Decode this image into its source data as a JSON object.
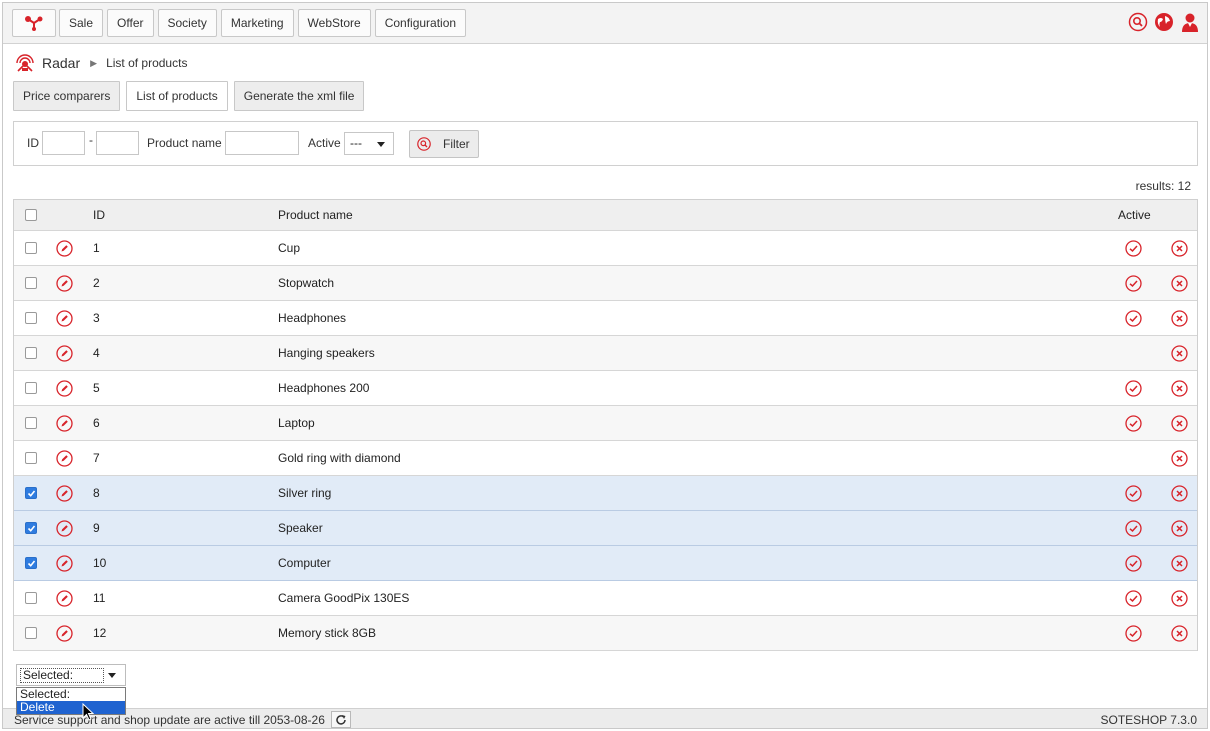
{
  "nav": {
    "logo_icon": "soteshop-logo-icon",
    "items": [
      {
        "label": "Sale"
      },
      {
        "label": "Offer"
      },
      {
        "label": "Society"
      },
      {
        "label": "Marketing"
      },
      {
        "label": "WebStore"
      },
      {
        "label": "Configuration"
      }
    ],
    "right_icons": [
      "search-icon",
      "globe-icon",
      "user-icon"
    ]
  },
  "breadcrumb": {
    "icon": "radar-icon",
    "section": "Radar",
    "current": "List of products"
  },
  "tabs": [
    {
      "label": "Price comparers",
      "active": false
    },
    {
      "label": "List of products",
      "active": true
    },
    {
      "label": "Generate the xml file",
      "active": false
    }
  ],
  "filter": {
    "id_label": "ID",
    "range_sep": "-",
    "product_name_label": "Product name",
    "active_label": "Active",
    "active_value": "---",
    "button_label": "Filter",
    "id_from": "",
    "id_to": "",
    "product_name": ""
  },
  "results": "results: 12",
  "table": {
    "headers": {
      "id": "ID",
      "name": "Product name",
      "active": "Active"
    },
    "rows": [
      {
        "id": "1",
        "name": "Cup",
        "active": true,
        "checked": false
      },
      {
        "id": "2",
        "name": "Stopwatch",
        "active": true,
        "checked": false
      },
      {
        "id": "3",
        "name": "Headphones",
        "active": true,
        "checked": false
      },
      {
        "id": "4",
        "name": "Hanging speakers",
        "active": false,
        "checked": false
      },
      {
        "id": "5",
        "name": "Headphones 200",
        "active": true,
        "checked": false
      },
      {
        "id": "6",
        "name": "Laptop",
        "active": true,
        "checked": false
      },
      {
        "id": "7",
        "name": "Gold ring with diamond",
        "active": false,
        "checked": false
      },
      {
        "id": "8",
        "name": "Silver ring",
        "active": true,
        "checked": true
      },
      {
        "id": "9",
        "name": "Speaker",
        "active": true,
        "checked": true
      },
      {
        "id": "10",
        "name": "Computer",
        "active": true,
        "checked": true
      },
      {
        "id": "11",
        "name": "Camera GoodPix 130ES",
        "active": true,
        "checked": false
      },
      {
        "id": "12",
        "name": "Memory stick 8GB",
        "active": true,
        "checked": false
      }
    ]
  },
  "bulk": {
    "selected_value": "Selected:",
    "options": [
      "Selected:",
      "Delete"
    ],
    "highlighted": "Delete"
  },
  "footer": {
    "text": "Service support and shop update are active till 2053-08-26",
    "version": "SOTESHOP 7.3.0"
  },
  "colors": {
    "accent": "#d8232a",
    "selection": "#e1ebf7",
    "highlight": "#1f63d0"
  }
}
